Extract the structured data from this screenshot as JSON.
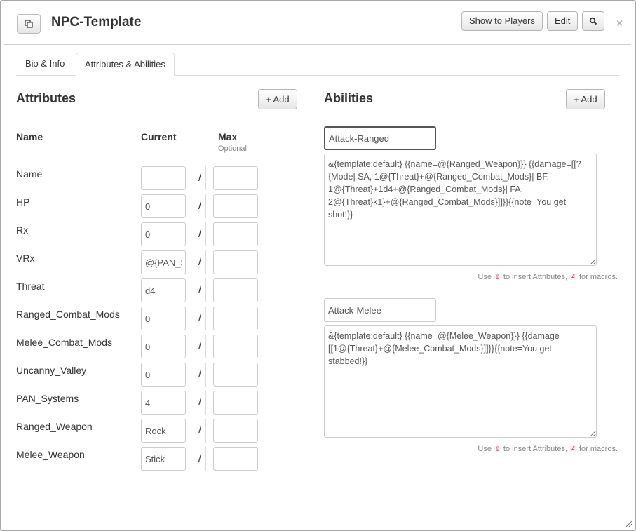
{
  "header": {
    "title": "NPC-Template",
    "show_to_players": "Show to Players",
    "edit": "Edit",
    "close": "×"
  },
  "tabs": [
    {
      "label": "Bio & Info",
      "active": false
    },
    {
      "label": "Attributes & Abilities",
      "active": true
    }
  ],
  "attributes": {
    "title": "Attributes",
    "add_label": "+ Add",
    "columns": {
      "name": "Name",
      "current": "Current",
      "max": "Max",
      "max_note": "Optional"
    },
    "rows": [
      {
        "name": "Name",
        "current": "",
        "max": ""
      },
      {
        "name": "HP",
        "current": "0",
        "max": ""
      },
      {
        "name": "Rx",
        "current": "0",
        "max": ""
      },
      {
        "name": "VRx",
        "current": "@{PAN_Systems}",
        "max": ""
      },
      {
        "name": "Threat",
        "current": "d4",
        "max": ""
      },
      {
        "name": "Ranged_Combat_Mods",
        "current": "0",
        "max": ""
      },
      {
        "name": "Melee_Combat_Mods",
        "current": "0",
        "max": ""
      },
      {
        "name": "Uncanny_Valley",
        "current": "0",
        "max": ""
      },
      {
        "name": "PAN_Systems",
        "current": "4",
        "max": ""
      },
      {
        "name": "Ranged_Weapon",
        "current": "Rock",
        "max": ""
      },
      {
        "name": "Melee_Weapon",
        "current": "Stick",
        "max": ""
      }
    ]
  },
  "abilities": {
    "title": "Abilities",
    "add_label": "+ Add",
    "hint": {
      "prefix": "Use",
      "attr_symbol": "@",
      "middle": "to insert Attributes,",
      "macro_symbol": "#",
      "suffix": "for macros."
    },
    "items": [
      {
        "name": "Attack-Ranged",
        "text": "&{template:default} {{name=@{Ranged_Weapon}}} {{damage=[[?{Mode| SA, 1@{Threat}+@{Ranged_Combat_Mods}| BF, 1@{Threat}+1d4+@{Ranged_Combat_Mods}| FA, 2@{Threat}k1}+@{Ranged_Combat_Mods}]]}}{{note=You get shot!}}"
      },
      {
        "name": "Attack-Melee",
        "text": "&{template:default} {{name=@{Melee_Weapon}}} {{damage=[[1@{Threat}+@{Melee_Combat_Mods}]]}}{{note=You get stabbed!}}"
      }
    ]
  },
  "icons": [
    "popout-icon",
    "search-icon",
    "close-icon",
    "resize-grip-icon"
  ],
  "colors": {
    "border": "#cccccc",
    "text": "#333333",
    "muted": "#888888",
    "code": "#c7254e"
  }
}
